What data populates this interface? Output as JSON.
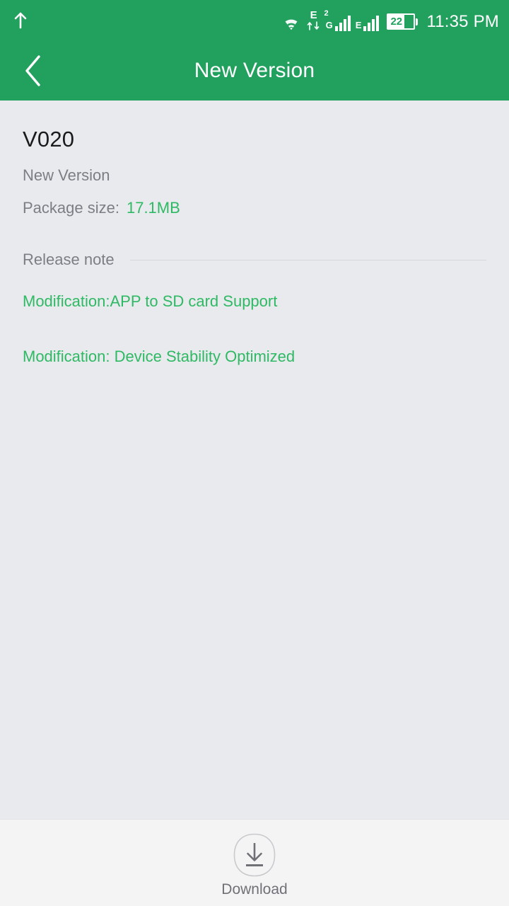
{
  "status_bar": {
    "notification_icon": "upload-arrow-icon",
    "wifi_icon": "wifi-icon",
    "network_type_1": "E",
    "sim_superscript": "2",
    "network_type_2": "G",
    "network_type_3": "E",
    "battery_level": "22",
    "time": "11:35 PM",
    "background_color": "#22a05e"
  },
  "app_bar": {
    "back_icon": "chevron-left-icon",
    "title": "New Version",
    "background_color": "#22a05e",
    "title_color": "#ffffff"
  },
  "content": {
    "version": "V020",
    "version_subtitle": "New Version",
    "package_size_label": "Package size:",
    "package_size_value": "17.1MB",
    "release_note_label": "Release note",
    "notes": [
      "Modification:APP to SD card Support",
      "Modification: Device Stability Optimized"
    ],
    "accent_color": "#2fb964",
    "background_color": "#e9eaee",
    "muted_text_color": "#7c7e85"
  },
  "bottom_bar": {
    "download_icon": "download-icon",
    "download_label": "Download",
    "background_color": "#f4f4f5"
  }
}
